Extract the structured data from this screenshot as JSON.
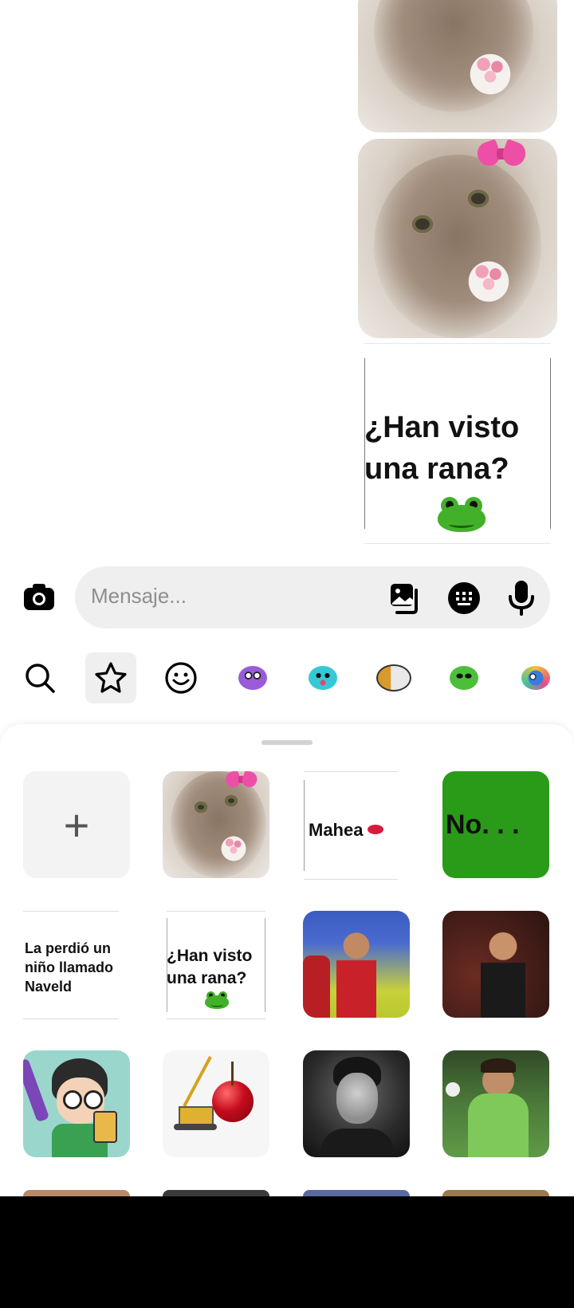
{
  "chat": {
    "text_sticker": {
      "line1": "¿Han visto",
      "line2": "una rana?"
    }
  },
  "composer": {
    "placeholder": "Mensaje..."
  },
  "tabs": [
    "search-icon",
    "star-icon",
    "smiley-icon",
    "purple-creature-sticker",
    "teal-blob-sticker",
    "mixed-character-sticker",
    "frog-sticker",
    "colorful-creature-sticker"
  ],
  "stickers": {
    "add_label": "+",
    "mahea": "Mahea",
    "no": "No. . .",
    "lost_child": {
      "line1": "La perdió un",
      "line2": "niño llamado",
      "line3": "Naveld"
    },
    "frog_q": {
      "line1": "¿Han visto",
      "line2": "una rana?"
    }
  },
  "colors": {
    "accent_green": "#2a9a19",
    "bow_pink": "#ee4fa6"
  }
}
